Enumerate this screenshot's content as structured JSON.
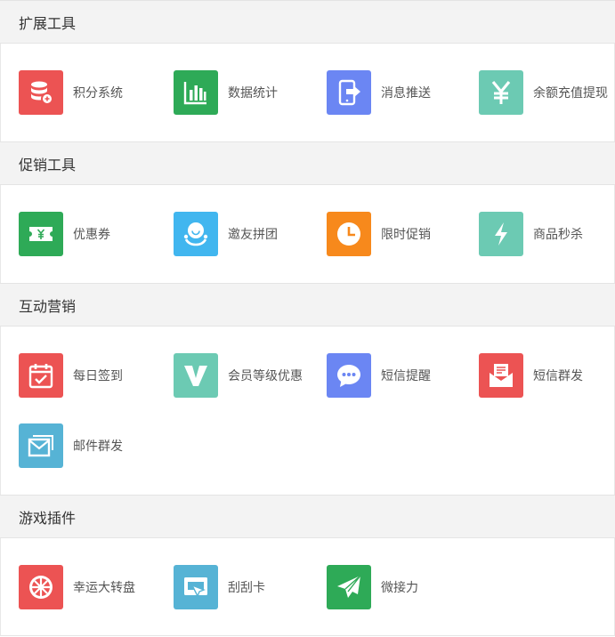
{
  "colors": {
    "red": "#ec5353",
    "green": "#2eaa57",
    "blue": "#6b86f3",
    "teal": "#6ccab3",
    "sky": "#41b6ef",
    "orange": "#f7891c",
    "lightblue": "#56b3d5",
    "header_bg": "#f3f3f3"
  },
  "sections": [
    {
      "title": "扩展工具",
      "items": [
        {
          "label": "积分系统",
          "icon": "database-icon",
          "color": "#ec5353"
        },
        {
          "label": "数据统计",
          "icon": "bar-chart-icon",
          "color": "#2eaa57"
        },
        {
          "label": "消息推送",
          "icon": "phone-push-icon",
          "color": "#6b86f3"
        },
        {
          "label": "余额充值提现",
          "icon": "yen-icon",
          "color": "#6ccab3"
        }
      ]
    },
    {
      "title": "促销工具",
      "items": [
        {
          "label": "优惠券",
          "icon": "coupon-icon",
          "color": "#2eaa57"
        },
        {
          "label": "邀友拼团",
          "icon": "group-buy-icon",
          "color": "#41b6ef"
        },
        {
          "label": "限时促销",
          "icon": "clock-icon",
          "color": "#f7891c"
        },
        {
          "label": "商品秒杀",
          "icon": "lightning-icon",
          "color": "#6ccab3"
        }
      ]
    },
    {
      "title": "互动营销",
      "items": [
        {
          "label": "每日签到",
          "icon": "calendar-check-icon",
          "color": "#ec5353"
        },
        {
          "label": "会员等级优惠",
          "icon": "vip-v-icon",
          "color": "#6ccab3"
        },
        {
          "label": "短信提醒",
          "icon": "chat-bubble-icon",
          "color": "#6b86f3"
        },
        {
          "label": "短信群发",
          "icon": "envelope-letter-icon",
          "color": "#ec5353"
        },
        {
          "label": "邮件群发",
          "icon": "mail-stack-icon",
          "color": "#56b3d5"
        }
      ]
    },
    {
      "title": "游戏插件",
      "items": [
        {
          "label": "幸运大转盘",
          "icon": "wheel-icon",
          "color": "#ec5353"
        },
        {
          "label": "刮刮卡",
          "icon": "scratch-card-icon",
          "color": "#56b3d5"
        },
        {
          "label": "微接力",
          "icon": "paper-plane-icon",
          "color": "#2eaa57"
        }
      ]
    }
  ]
}
